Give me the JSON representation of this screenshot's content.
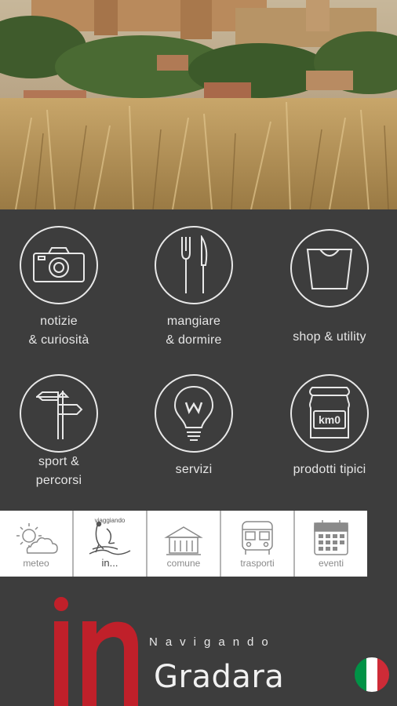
{
  "hero": {
    "image": "gradara-castle-wheat-field-photo"
  },
  "menu": [
    {
      "id": "notizie",
      "label": "notizie\n& curiosità",
      "icon": "camera-icon"
    },
    {
      "id": "mangiare",
      "label": "mangiare\n& dormire",
      "icon": "fork-knife-icon"
    },
    {
      "id": "shop",
      "label": "shop & utility",
      "icon": "shopping-bag-icon"
    },
    {
      "id": "sport",
      "label": "sport &\npercorsi",
      "icon": "signpost-icon"
    },
    {
      "id": "servizi",
      "label": "servizi",
      "icon": "lightbulb-icon"
    },
    {
      "id": "prodotti",
      "label": "prodotti tipici",
      "icon": "jar-icon",
      "jar_text": "km0"
    }
  ],
  "strip": [
    {
      "id": "meteo",
      "label": "meteo",
      "icon": "sun-cloud-icon"
    },
    {
      "id": "viaggiando",
      "label": "in...",
      "caption": "viaggiando",
      "icon": "figure-logo-icon"
    },
    {
      "id": "comune",
      "label": "comune",
      "icon": "town-hall-icon"
    },
    {
      "id": "trasporti",
      "label": "trasporti",
      "icon": "bus-icon"
    },
    {
      "id": "eventi",
      "label": "eventi",
      "icon": "calendar-icon"
    }
  ],
  "brand": {
    "logo_text": "in",
    "subtitle": "Navigando",
    "name": "Gradara",
    "accent": "#c0202a"
  },
  "language": {
    "flag": "italy-flag-icon",
    "colors": [
      "#009246",
      "#ffffff",
      "#ce2b37"
    ]
  }
}
